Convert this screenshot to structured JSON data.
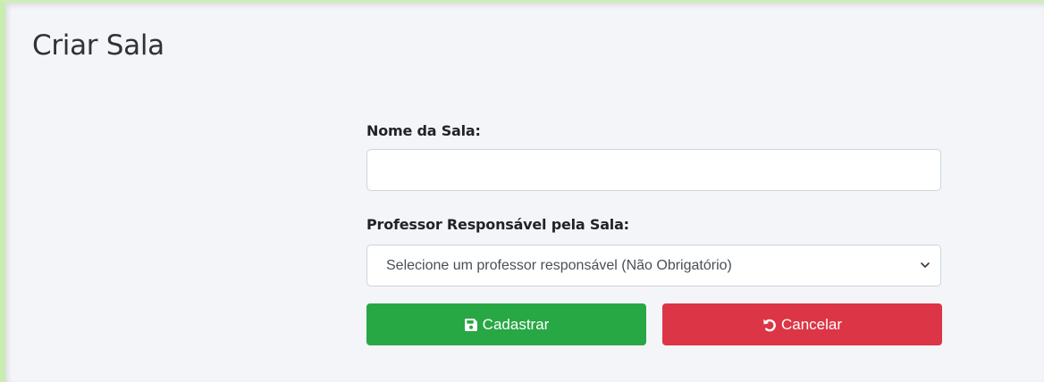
{
  "page": {
    "title": "Criar Sala"
  },
  "form": {
    "room_name": {
      "label": "Nome da Sala:",
      "value": ""
    },
    "teacher": {
      "label": "Professor Responsável pela Sala:",
      "selected": "Selecione um professor responsável (Não Obrigatório)"
    },
    "buttons": {
      "save_label": "Cadastrar",
      "save_icon": "save-icon",
      "save_color": "#28a745",
      "cancel_label": "Cancelar",
      "cancel_icon": "undo-icon",
      "cancel_color": "#dc3545"
    }
  }
}
